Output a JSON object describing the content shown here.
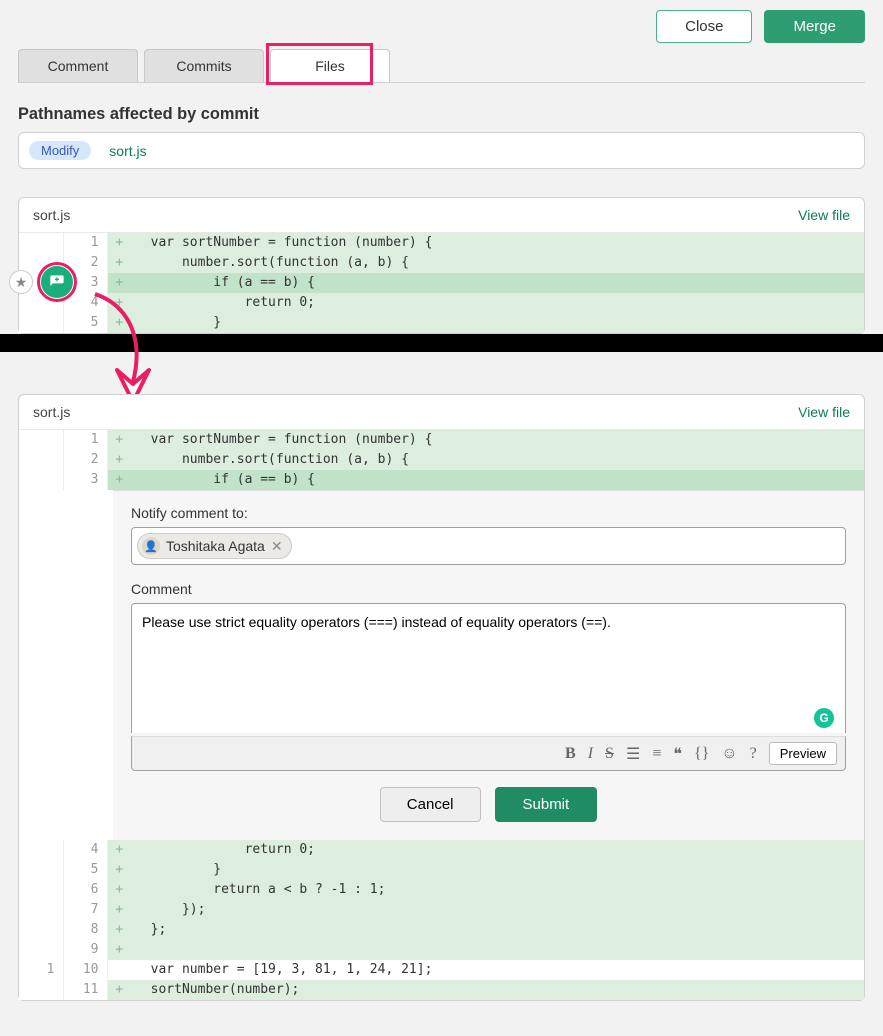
{
  "top": {
    "close": "Close",
    "merge": "Merge"
  },
  "tabs": {
    "comment": "Comment",
    "commits": "Commits",
    "files": "Files"
  },
  "section_title": "Pathnames affected by commit",
  "pathnames": {
    "badge": "Modify",
    "file": "sort.js"
  },
  "diff1": {
    "file": "sort.js",
    "view": "View file",
    "lines": [
      {
        "n": 1,
        "m": "+",
        "c": "  var sortNumber = function (number) {"
      },
      {
        "n": 2,
        "m": "+",
        "c": "      number.sort(function (a, b) {"
      },
      {
        "n": 3,
        "m": "+",
        "c": "          if (a == b) {",
        "hl": true
      },
      {
        "n": 4,
        "m": "+",
        "c": "              return 0;"
      },
      {
        "n": 5,
        "m": "+",
        "c": "          }"
      }
    ]
  },
  "diff2": {
    "file": "sort.js",
    "view": "View file",
    "lines_top": [
      {
        "n": 1,
        "m": "+",
        "c": "  var sortNumber = function (number) {"
      },
      {
        "n": 2,
        "m": "+",
        "c": "      number.sort(function (a, b) {"
      },
      {
        "n": 3,
        "m": "+",
        "c": "          if (a == b) {",
        "hl": true
      }
    ],
    "lines_bottom": [
      {
        "o": "",
        "n": 4,
        "m": "+",
        "c": "              return 0;"
      },
      {
        "o": "",
        "n": 5,
        "m": "+",
        "c": "          }"
      },
      {
        "o": "",
        "n": 6,
        "m": "+",
        "c": "          return a < b ? -1 : 1;"
      },
      {
        "o": "",
        "n": 7,
        "m": "+",
        "c": "      });"
      },
      {
        "o": "",
        "n": 8,
        "m": "+",
        "c": "  };"
      },
      {
        "o": "",
        "n": 9,
        "m": "+",
        "c": ""
      },
      {
        "o": 1,
        "n": 10,
        "m": "",
        "c": "  var number = [19, 3, 81, 1, 24, 21];",
        "ctx": true
      },
      {
        "o": "",
        "n": 11,
        "m": "+",
        "c": "  sortNumber(number);"
      }
    ]
  },
  "form": {
    "notify_label": "Notify comment to:",
    "chip_name": "Toshitaka Agata",
    "comment_label": "Comment",
    "comment_text": "Please use strict equality operators (===) instead of equality operators (==).",
    "preview": "Preview",
    "cancel": "Cancel",
    "submit": "Submit"
  }
}
